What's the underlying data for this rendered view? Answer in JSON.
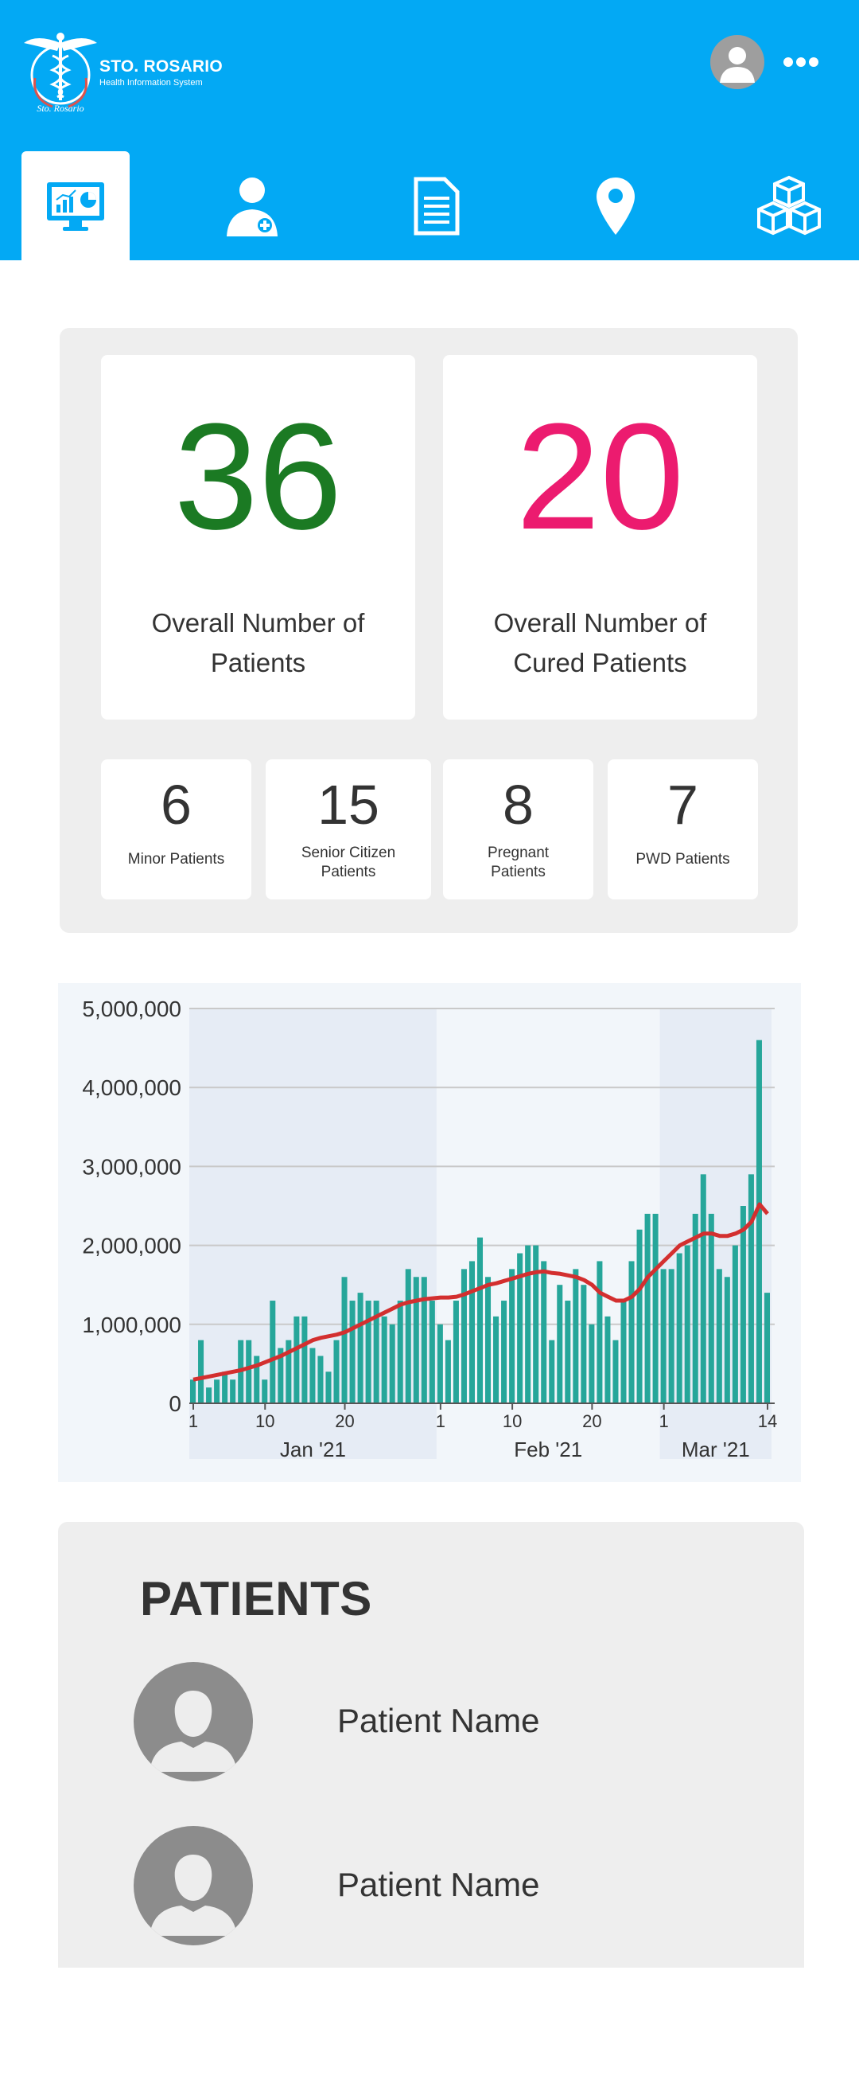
{
  "header": {
    "brand_name": "STO. ROSARIO",
    "brand_subtitle": "Health Information System",
    "logo_text": "Sto. Rosario",
    "background_color": "#03a9f4",
    "user_avatar_icon": "user-avatar-icon",
    "menu_icon": "more-horizontal-icon"
  },
  "nav": {
    "active_index": 0,
    "items": [
      {
        "icon": "dashboard-monitor-icon"
      },
      {
        "icon": "doctor-icon"
      },
      {
        "icon": "document-icon"
      },
      {
        "icon": "location-pin-icon"
      },
      {
        "icon": "inventory-boxes-icon"
      }
    ]
  },
  "stats": {
    "overall_patients": {
      "value": "36",
      "label": "Overall Number of Patients",
      "color": "#1b7a23"
    },
    "cured_patients": {
      "value": "20",
      "label": "Overall Number of Cured Patients",
      "color": "#ec1b6f"
    },
    "breakdown": [
      {
        "value": "6",
        "label": "Minor Patients"
      },
      {
        "value": "15",
        "label": "Senior Citizen Patients"
      },
      {
        "value": "8",
        "label": "Pregnant Patients"
      },
      {
        "value": "7",
        "label": "PWD Patients"
      }
    ]
  },
  "chart_data": {
    "type": "bar",
    "ylim": [
      0,
      5000000
    ],
    "yticks": [
      "0",
      "1,000,000",
      "2,000,000",
      "3,000,000",
      "4,000,000",
      "5,000,000"
    ],
    "xticks": [
      "1",
      "10",
      "20",
      "1",
      "10",
      "20",
      "1",
      "14"
    ],
    "month_labels": [
      "Jan '21",
      "Feb '21",
      "Mar '21"
    ],
    "bar_color": "#26a69a",
    "line_color": "#d32f2f",
    "series": [
      {
        "type": "bar",
        "values": [
          300000,
          800000,
          200000,
          300000,
          400000,
          300000,
          800000,
          800000,
          600000,
          300000,
          1300000,
          700000,
          800000,
          1100000,
          1100000,
          700000,
          600000,
          400000,
          800000,
          1600000,
          1300000,
          1400000,
          1300000,
          1300000,
          1100000,
          1000000,
          1300000,
          1700000,
          1600000,
          1600000,
          1300000,
          1000000,
          800000,
          1300000,
          1700000,
          1800000,
          2100000,
          1600000,
          1100000,
          1300000,
          1700000,
          1900000,
          2000000,
          2000000,
          1800000,
          800000,
          1500000,
          1300000,
          1700000,
          1500000,
          1000000,
          1800000,
          1100000,
          800000,
          1300000,
          1800000,
          2200000,
          2400000,
          2400000,
          1700000,
          1700000,
          1900000,
          2000000,
          2400000,
          2900000,
          2400000,
          1700000,
          1600000,
          2000000,
          2500000,
          2900000,
          4600000,
          1400000
        ]
      },
      {
        "type": "line",
        "values": [
          300000,
          320000,
          340000,
          360000,
          380000,
          400000,
          420000,
          450000,
          480000,
          520000,
          560000,
          600000,
          650000,
          700000,
          750000,
          800000,
          830000,
          850000,
          870000,
          900000,
          950000,
          1000000,
          1050000,
          1100000,
          1150000,
          1200000,
          1250000,
          1280000,
          1300000,
          1320000,
          1330000,
          1340000,
          1340000,
          1350000,
          1380000,
          1420000,
          1460000,
          1500000,
          1520000,
          1550000,
          1580000,
          1610000,
          1640000,
          1660000,
          1670000,
          1650000,
          1640000,
          1620000,
          1600000,
          1560000,
          1500000,
          1400000,
          1350000,
          1300000,
          1300000,
          1350000,
          1450000,
          1600000,
          1700000,
          1800000,
          1900000,
          2000000,
          2050000,
          2100000,
          2150000,
          2150000,
          2120000,
          2120000,
          2150000,
          2200000,
          2300000,
          2520000,
          2400000
        ]
      }
    ]
  },
  "patients": {
    "title": "PATIENTS",
    "list": [
      {
        "name": "Patient Name",
        "icon": "patient-avatar-icon"
      },
      {
        "name": "Patient Name",
        "icon": "patient-avatar-icon"
      }
    ]
  }
}
